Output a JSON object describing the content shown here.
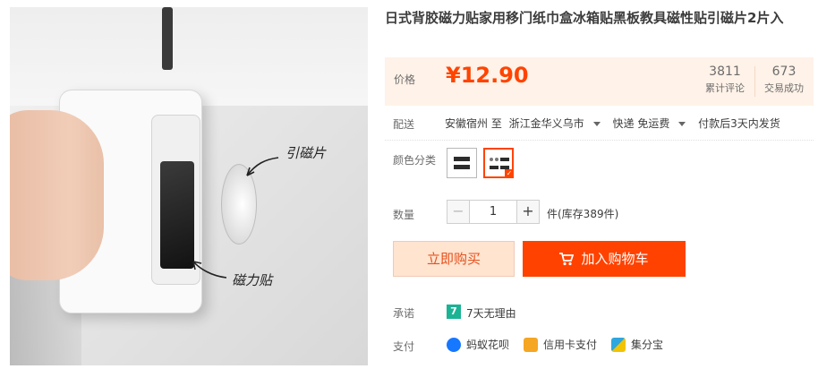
{
  "product": {
    "title": "日式背胶磁力贴家用移门纸巾盒冰箱贴黑板教具磁性贴引磁片2片入",
    "image_notes": [
      "引磁片",
      "磁力贴"
    ]
  },
  "price": {
    "label": "价格",
    "value": "¥12.90",
    "accent_color": "#ff4400"
  },
  "stats": [
    {
      "value": "3811",
      "label": "累计评论"
    },
    {
      "value": "673",
      "label": "交易成功"
    }
  ],
  "shipping": {
    "label": "配送",
    "from": "安徽宿州 至",
    "to": "浙江金华义乌市",
    "method": "快递 免运费",
    "delivery": "付款后3天内发货"
  },
  "color": {
    "label": "颜色分类",
    "selected_index": 1,
    "option_count": 2
  },
  "quantity": {
    "label": "数量",
    "value": "1",
    "minus": "−",
    "plus": "+",
    "stock": "件(库存389件)"
  },
  "actions": {
    "buy_now": "立即购买",
    "add_to_cart": "加入购物车",
    "cart_icon": "cart-icon"
  },
  "promise": {
    "label": "承诺",
    "icon_text": "7",
    "text": "7天无理由"
  },
  "payment": {
    "label": "支付",
    "methods": [
      {
        "name": "蚂蚁花呗",
        "icon": "huabei-icon",
        "color": "#1677ff"
      },
      {
        "name": "信用卡支付",
        "icon": "credit-card-icon",
        "color": "#f5a623"
      },
      {
        "name": "集分宝",
        "icon": "jifenbao-icon",
        "color": "#2ea7e0"
      }
    ]
  }
}
